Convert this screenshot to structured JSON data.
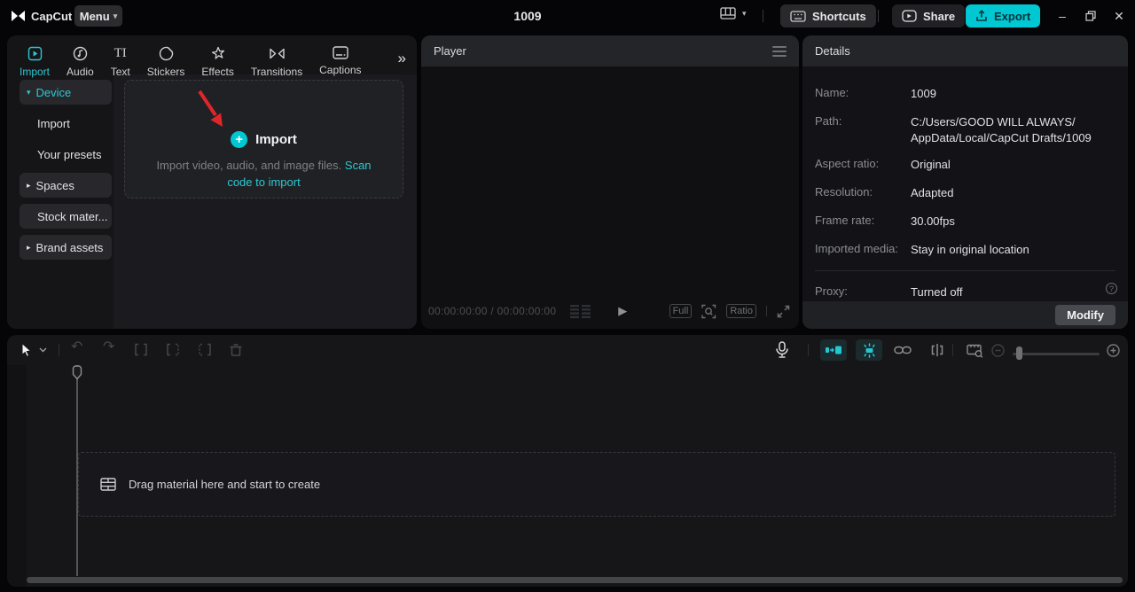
{
  "colors": {
    "accent": "#00c8d2",
    "arrow_red": "#e0262a"
  },
  "titlebar": {
    "app_name": "CapCut",
    "menu_label": "Menu",
    "project_title": "1009",
    "shortcuts_label": "Shortcuts",
    "share_label": "Share",
    "export_label": "Export"
  },
  "media_panel": {
    "tabs": [
      {
        "label": "Import",
        "active": true
      },
      {
        "label": "Audio"
      },
      {
        "label": "Text"
      },
      {
        "label": "Stickers"
      },
      {
        "label": "Effects"
      },
      {
        "label": "Transitions"
      },
      {
        "label": "Captions"
      }
    ],
    "sidebar": [
      {
        "label": "Device",
        "active": true,
        "expanded": true
      },
      {
        "label": "Import",
        "child": true
      },
      {
        "label": "Your presets",
        "child": true
      },
      {
        "label": "Spaces",
        "collapsed": true
      },
      {
        "label": "Stock mater..."
      },
      {
        "label": "Brand assets",
        "collapsed": true
      }
    ],
    "dropzone": {
      "title": "Import",
      "description": "Import video, audio, and image files.",
      "link_label": "Scan code to import"
    }
  },
  "player": {
    "title": "Player",
    "timecode": "00:00:00:00 / 00:00:00:00",
    "full_label": "Full",
    "ratio_label": "Ratio"
  },
  "details": {
    "title": "Details",
    "rows": [
      {
        "label": "Name:",
        "value": "1009"
      },
      {
        "label": "Path:",
        "lines": [
          "C:/Users/GOOD WILL ALWAYS/",
          "AppData/Local/CapCut Drafts/1009"
        ]
      },
      {
        "label": "Aspect ratio:",
        "value": "Original"
      },
      {
        "label": "Resolution:",
        "value": "Adapted"
      },
      {
        "label": "Frame rate:",
        "value": "30.00fps"
      },
      {
        "label": "Imported media:",
        "value": "Stay in original location"
      }
    ],
    "proxy_label": "Proxy:",
    "proxy_value": "Turned off",
    "modify_label": "Modify"
  },
  "timeline": {
    "empty_text": "Drag material here and start to create"
  },
  "glyphs": {
    "caret_down": "▾",
    "arrow_right": "▸",
    "double_chevron": "»",
    "play": "▶",
    "undo": "↶",
    "redo": "↷",
    "minimize": "–",
    "close": "✕",
    "plus": "+",
    "question": "?",
    "text_tab": "TI"
  }
}
